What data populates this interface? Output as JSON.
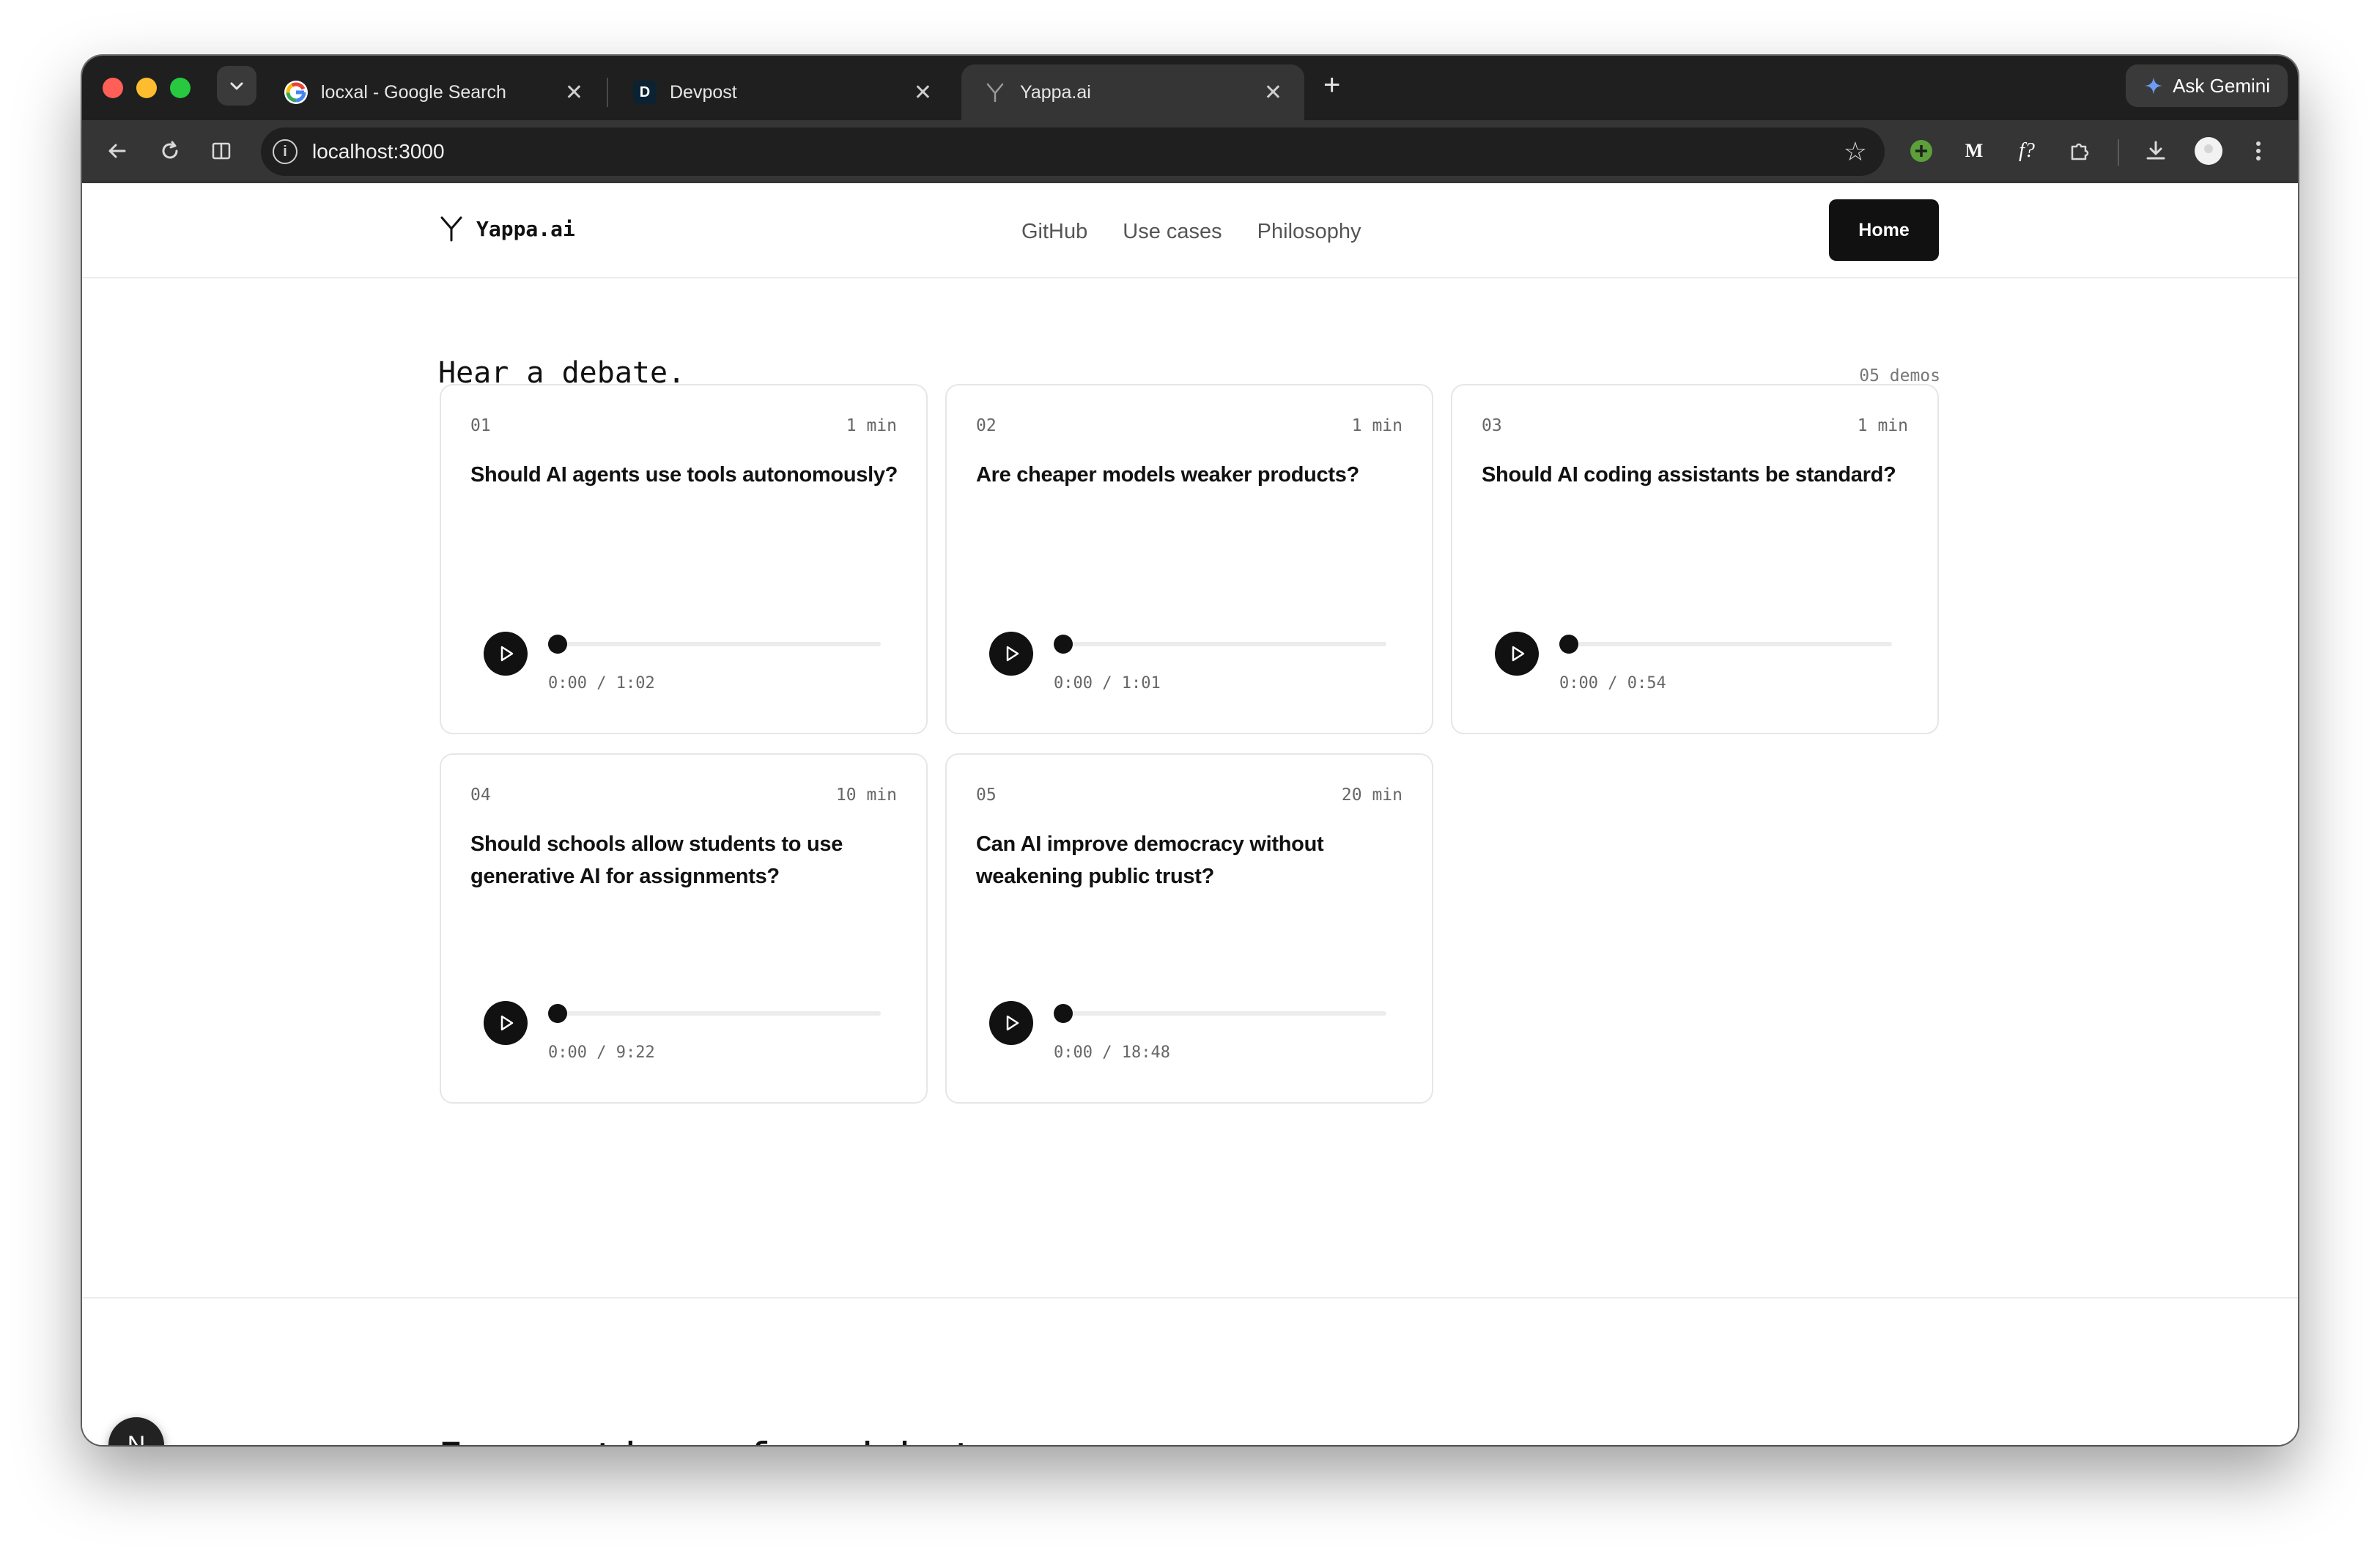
{
  "browser": {
    "tabs": [
      {
        "title": "locxal - Google Search",
        "favicon": "google-icon"
      },
      {
        "title": "Devpost",
        "favicon": "D"
      },
      {
        "title": "Yappa.ai",
        "favicon": "Y"
      }
    ],
    "close_glyph": "✕",
    "new_tab_glyph": "+",
    "gemini_label": "Ask Gemini",
    "url": "localhost:3000",
    "extensions": [
      "M",
      "f?"
    ]
  },
  "nav": {
    "logo_text": "Yappa.ai",
    "links": [
      "GitHub",
      "Use cases",
      "Philosophy"
    ],
    "home_label": "Home"
  },
  "main": {
    "title": "Hear a debate.",
    "demo_count": "05 demos",
    "cards": [
      {
        "num": "01",
        "duration": "1 min",
        "question": "Should AI agents use tools autonomously?",
        "time": "0:00 / 1:02",
        "progress": 0
      },
      {
        "num": "02",
        "duration": "1 min",
        "question": "Are cheaper models weaker products?",
        "time": "0:00 / 1:01",
        "progress": 0
      },
      {
        "num": "03",
        "duration": "1 min",
        "question": "Should AI coding assistants be standard?",
        "time": "0:00 / 0:54",
        "progress": 0
      },
      {
        "num": "04",
        "duration": "10 min",
        "question": "Should schools allow students to use generative AI for assignments?",
        "time": "0:00 / 9:22",
        "progress": 0
      },
      {
        "num": "05",
        "duration": "20 min",
        "question": "Can AI improve democracy without weakening public trust?",
        "time": "0:00 / 18:48",
        "progress": 0
      }
    ],
    "next_heading": "Inspection of a debate"
  },
  "dev_badge": "N",
  "colors": {
    "tab_strip": "#1f1f1f",
    "toolbar": "#353535",
    "accent_dark": "#111111",
    "traffic_red": "#ff5f57",
    "traffic_yellow": "#febc2e",
    "traffic_green": "#28c840"
  }
}
